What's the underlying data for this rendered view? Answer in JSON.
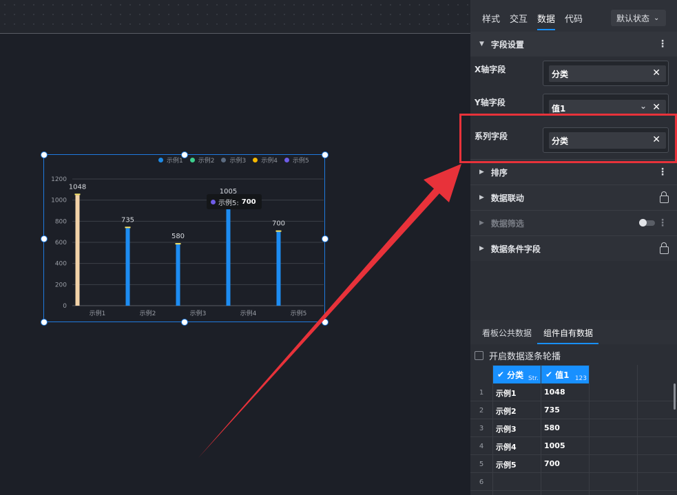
{
  "canvas": {
    "legend": [
      {
        "label": "示例1",
        "color": "#1d89e4"
      },
      {
        "label": "示例2",
        "color": "#3ecf8e"
      },
      {
        "label": "示例3",
        "color": "#5b6b80"
      },
      {
        "label": "示例4",
        "color": "#f5b800"
      },
      {
        "label": "示例5",
        "color": "#6e5ce6"
      }
    ],
    "tooltip": {
      "label": "示例5:",
      "value": "700"
    }
  },
  "chart_data": {
    "type": "bar",
    "categories": [
      "示例1",
      "示例2",
      "示例3",
      "示例4",
      "示例5"
    ],
    "values": [
      1048,
      735,
      580,
      1005,
      700
    ],
    "data_labels": [
      "1048",
      "735",
      "580",
      "1005",
      "700"
    ],
    "yticks": [
      "0",
      "200",
      "400",
      "600",
      "800",
      "1000",
      "1200"
    ],
    "ylim": [
      0,
      1200
    ],
    "grid": true,
    "legend_position": "top-right",
    "colors": [
      "#f2d2a8",
      "#1d8cf2",
      "#1d8cf2",
      "#1d8cf2",
      "#1d8cf2"
    ],
    "cap_color": "#f5e46b"
  },
  "panel": {
    "tabs": [
      "样式",
      "交互",
      "数据",
      "代码"
    ],
    "active_tab": "数据",
    "state_select": "默认状态",
    "field_section": "字段设置",
    "fields": [
      {
        "label": "X轴字段",
        "value": "分类"
      },
      {
        "label": "Y轴字段",
        "value": "值1"
      },
      {
        "label": "系列字段",
        "value": "分类"
      }
    ],
    "sections": [
      "排序",
      "数据联动",
      "数据筛选",
      "数据条件字段"
    ],
    "data_tabs": [
      "看板公共数据",
      "组件自有数据"
    ],
    "carousel_label": "开启数据逐条轮播",
    "table": {
      "columns": [
        {
          "name": "分类",
          "type": "Str."
        },
        {
          "name": "值1",
          "type": "123"
        }
      ],
      "rows": [
        {
          "num": "1",
          "cat": "示例1",
          "val": "1048"
        },
        {
          "num": "2",
          "cat": "示例2",
          "val": "735"
        },
        {
          "num": "3",
          "cat": "示例3",
          "val": "580"
        },
        {
          "num": "4",
          "cat": "示例4",
          "val": "1005"
        },
        {
          "num": "5",
          "cat": "示例5",
          "val": "700"
        },
        {
          "num": "6",
          "cat": "",
          "val": ""
        }
      ]
    }
  }
}
